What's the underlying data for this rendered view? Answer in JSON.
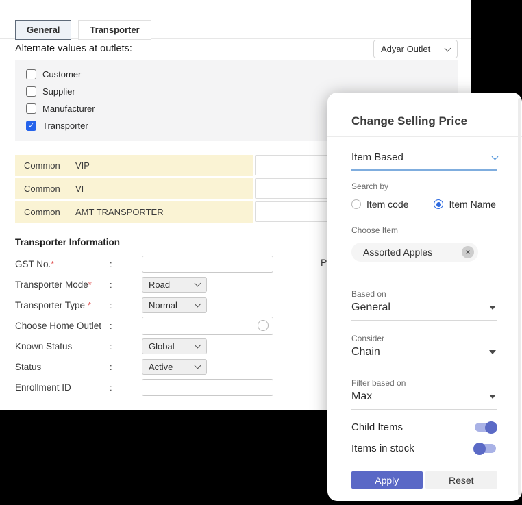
{
  "page": {
    "tabs": [
      {
        "label": "General",
        "active": true
      },
      {
        "label": "Transporter",
        "active": false
      }
    ],
    "alternate_label": "Alternate values at outlets:",
    "outlet_select": {
      "value": "Adyar Outlet"
    },
    "checkbox_group": [
      {
        "label": "Customer",
        "checked": false
      },
      {
        "label": "Supplier",
        "checked": false
      },
      {
        "label": "Manufacturer",
        "checked": false
      },
      {
        "label": "Transporter",
        "checked": true
      }
    ],
    "check_glyph": "✓",
    "common_rows": [
      {
        "scope": "Common",
        "name": "VIP",
        "value": ""
      },
      {
        "scope": "Common",
        "name": "VI",
        "value": ""
      },
      {
        "scope": "Common",
        "name": "AMT TRANSPORTER",
        "value": ""
      }
    ],
    "section_title": "Transporter Information",
    "colon": ":",
    "required_mark": "*",
    "form_rows": [
      {
        "label": "GST No.",
        "required": true,
        "type": "input",
        "value": ""
      },
      {
        "label": "Transporter Mode",
        "required": true,
        "type": "select",
        "value": "Road"
      },
      {
        "label": "Transporter Type ",
        "required": true,
        "type": "select",
        "value": "Normal"
      },
      {
        "label": "Choose Home Outlet",
        "required": false,
        "type": "input-circle",
        "value": ""
      },
      {
        "label": "Known Status",
        "required": false,
        "type": "select",
        "value": "Global"
      },
      {
        "label": "Status",
        "required": false,
        "type": "select",
        "value": "Active"
      },
      {
        "label": "Enrollment ID",
        "required": false,
        "type": "input",
        "value": ""
      }
    ],
    "partial_label": "P"
  },
  "modal": {
    "title": "Change Selling Price",
    "mode_select": {
      "value": "Item Based"
    },
    "search_by": {
      "label": "Search by",
      "options": [
        {
          "label": "Item code",
          "selected": false
        },
        {
          "label": "Item Name",
          "selected": true
        }
      ]
    },
    "choose_item": {
      "label": "Choose Item",
      "chip": "Assorted Apples",
      "remove_glyph": "✕"
    },
    "selects": [
      {
        "label": "Based on",
        "value": "General"
      },
      {
        "label": "Consider",
        "value": "Chain"
      },
      {
        "label": "Filter based on",
        "value": "Max"
      }
    ],
    "toggles": [
      {
        "label": "Child Items",
        "on": true
      },
      {
        "label": "Items in stock",
        "on": false
      }
    ],
    "apply_label": "Apply",
    "reset_label": "Reset"
  },
  "colors": {
    "accent_blue": "#2563eb",
    "radio_blue": "#2e6be0",
    "underline_blue": "#7fadde",
    "indigo_button": "#5a68c6",
    "toggle_track": "#a9b2e6",
    "toggle_knob": "#5b6ac6",
    "cream_row": "#faf3d4",
    "panel_gray": "#f4f4f5"
  }
}
